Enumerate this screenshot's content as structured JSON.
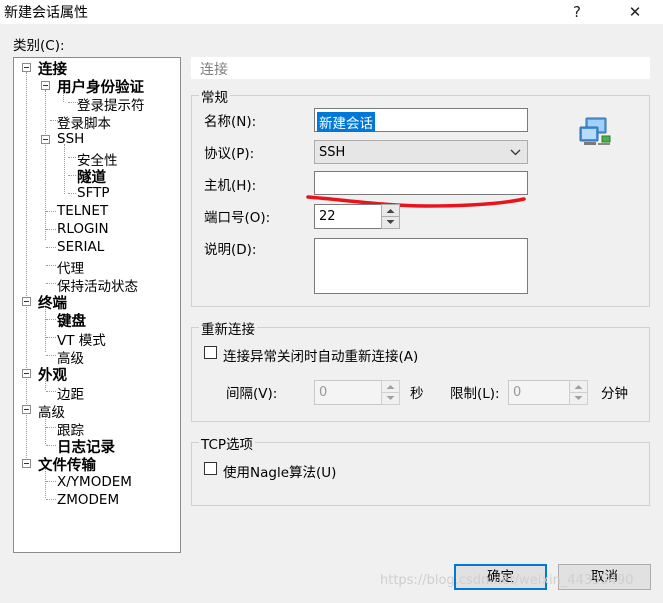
{
  "window": {
    "title": "新建会话属性",
    "help_icon": "?",
    "close_icon": "✕"
  },
  "category_label": "类别(C):",
  "tree": [
    {
      "label": "连接",
      "bold": true
    },
    {
      "label": "用户身份验证",
      "bold": true
    },
    {
      "label": "登录提示符",
      "bold": false
    },
    {
      "label": "登录脚本",
      "bold": false
    },
    {
      "label": "SSH",
      "bold": false
    },
    {
      "label": "安全性",
      "bold": false
    },
    {
      "label": "隧道",
      "bold": true
    },
    {
      "label": "SFTP",
      "bold": false
    },
    {
      "label": "TELNET",
      "bold": false
    },
    {
      "label": "RLOGIN",
      "bold": false
    },
    {
      "label": "SERIAL",
      "bold": false
    },
    {
      "label": "代理",
      "bold": false
    },
    {
      "label": "保持活动状态",
      "bold": false
    },
    {
      "label": "终端",
      "bold": true
    },
    {
      "label": "键盘",
      "bold": true
    },
    {
      "label": "VT 模式",
      "bold": false
    },
    {
      "label": "高级",
      "bold": false
    },
    {
      "label": "外观",
      "bold": true
    },
    {
      "label": "边距",
      "bold": false
    },
    {
      "label": "高级",
      "bold": false
    },
    {
      "label": "跟踪",
      "bold": false
    },
    {
      "label": "日志记录",
      "bold": true
    },
    {
      "label": "文件传输",
      "bold": true
    },
    {
      "label": "X/YMODEM",
      "bold": false
    },
    {
      "label": "ZMODEM",
      "bold": false
    }
  ],
  "panel": {
    "header": "连接",
    "general": {
      "title": "常规",
      "name_label": "名称(N):",
      "name_value": "新建会话",
      "protocol_label": "协议(P):",
      "protocol_value": "SSH",
      "host_label": "主机(H):",
      "host_value": "",
      "port_label": "端口号(O):",
      "port_value": "22",
      "desc_label": "说明(D):",
      "desc_value": "",
      "icon": "network-computers-icon"
    },
    "reconnect": {
      "title": "重新连接",
      "auto_label": "连接异常关闭时自动重新连接(A)",
      "interval_label": "间隔(V):",
      "interval_value": "0",
      "interval_unit": "秒",
      "limit_label": "限制(L):",
      "limit_value": "0",
      "limit_unit": "分钟"
    },
    "tcp": {
      "title": "TCP选项",
      "nagle_label": "使用Nagle算法(U)"
    }
  },
  "buttons": {
    "ok": "确定",
    "cancel": "取消"
  },
  "watermark": "https://blog.csdn.net/weixin_44355490",
  "colors": {
    "selection": "#0078d7",
    "annotation": "#e8141b",
    "default_button_border": "#0078d7"
  }
}
